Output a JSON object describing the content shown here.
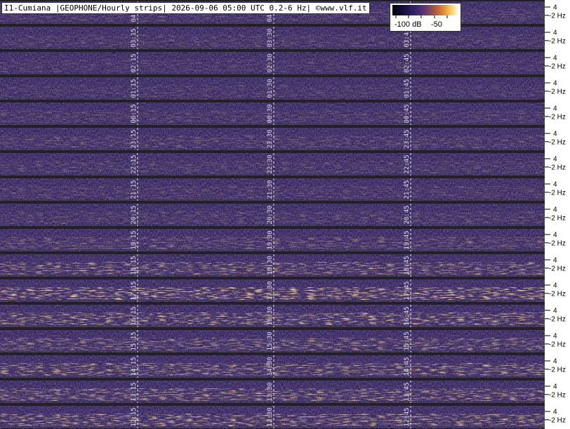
{
  "title": "I1-Cumiana |GEOPHONE/Hourly strips| 2026-09-06 05:00 UTC 0.2-6 Hz| ©www.vlf.it",
  "colorbar": {
    "min_label": "-100 dB",
    "max_label": "-50"
  },
  "axis": {
    "tick_upper": "4",
    "tick_lower": "2 Hz"
  },
  "colors": {
    "background": "#2a1f52",
    "hot": "#f0a030",
    "separator": "#222222",
    "marker": "#ffffff"
  },
  "chart_data": {
    "type": "heatmap",
    "title": "I1-Cumiana |GEOPHONE/Hourly strips| 2026-09-06 05:00 UTC 0.2-6 Hz| ©www.vlf.it",
    "colorbar_range_db": [
      -100,
      -50
    ],
    "y_ticks": [
      "4",
      "2 Hz"
    ],
    "strips": [
      {
        "hour": 4,
        "labels": [
          "04:15",
          "04:30",
          "04:45"
        ],
        "activity": 0.18
      },
      {
        "hour": 3,
        "labels": [
          "03:15",
          "03:30",
          "03:45"
        ],
        "activity": 0.18
      },
      {
        "hour": 2,
        "labels": [
          "02:15",
          "02:30",
          "02:45"
        ],
        "activity": 0.15
      },
      {
        "hour": 1,
        "labels": [
          "01:15",
          "01:30",
          "01:45"
        ],
        "activity": 0.15
      },
      {
        "hour": 0,
        "labels": [
          "00:15",
          "00:30",
          "00:45"
        ],
        "activity": 0.18
      },
      {
        "hour": 23,
        "labels": [
          "23:15",
          "23:30",
          "23:45"
        ],
        "activity": 0.22
      },
      {
        "hour": 22,
        "labels": [
          "22:15",
          "22:30",
          "22:45"
        ],
        "activity": 0.18
      },
      {
        "hour": 21,
        "labels": [
          "21:15",
          "21:30",
          "21:45"
        ],
        "activity": 0.18
      },
      {
        "hour": 20,
        "labels": [
          "20:15",
          "20:30",
          "20:45"
        ],
        "activity": 0.2
      },
      {
        "hour": 19,
        "labels": [
          "19:15",
          "19:30",
          "19:45"
        ],
        "activity": 0.3
      },
      {
        "hour": 18,
        "labels": [
          "18:15",
          "18:30",
          "18:45"
        ],
        "activity": 0.5
      },
      {
        "hour": 17,
        "labels": [
          "17:15",
          "17:30",
          "17:45"
        ],
        "activity": 0.75
      },
      {
        "hour": 16,
        "labels": [
          "16:15",
          "16:30",
          "16:45"
        ],
        "activity": 0.6
      },
      {
        "hour": 15,
        "labels": [
          "15:15",
          "15:30",
          "15:45"
        ],
        "activity": 0.45
      },
      {
        "hour": 14,
        "labels": [
          "14:15",
          "14:30",
          "14:45"
        ],
        "activity": 0.55
      },
      {
        "hour": 13,
        "labels": [
          "13:15",
          "13:30",
          "13:45"
        ],
        "activity": 0.55
      },
      {
        "hour": 12,
        "labels": [
          "12:15",
          "12:30",
          "12:45"
        ],
        "activity": 0.6
      }
    ]
  }
}
